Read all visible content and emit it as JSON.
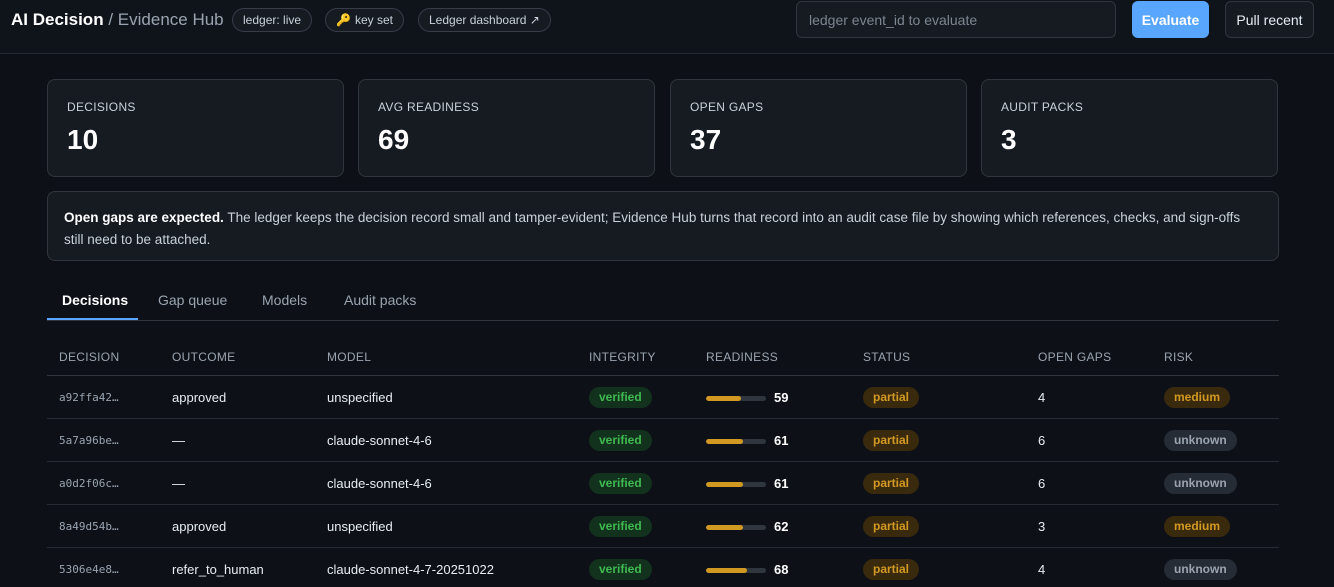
{
  "header": {
    "brand": "AI Decision",
    "separator": "/",
    "subtitle": "Evidence Hub",
    "chip_ledger": "ledger: live",
    "chip_key": "key set",
    "chip_dashboard": "Ledger dashboard ↗",
    "search_placeholder": "ledger event_id to evaluate",
    "evaluate_label": "Evaluate",
    "pull_label": "Pull recent"
  },
  "stats": [
    {
      "label": "DECISIONS",
      "value": "10"
    },
    {
      "label": "AVG READINESS",
      "value": "69"
    },
    {
      "label": "OPEN GAPS",
      "value": "37"
    },
    {
      "label": "AUDIT PACKS",
      "value": "3"
    }
  ],
  "notice": {
    "bold": "Open gaps are expected.",
    "text": " The ledger keeps the decision record small and tamper-evident; Evidence Hub turns that record into an audit case file by showing which references, checks, and sign-offs still need to be attached."
  },
  "tabs": [
    "Decisions",
    "Gap queue",
    "Models",
    "Audit packs"
  ],
  "table": {
    "columns": [
      "DECISION",
      "OUTCOME",
      "MODEL",
      "INTEGRITY",
      "READINESS",
      "STATUS",
      "OPEN GAPS",
      "RISK"
    ],
    "rows": [
      {
        "decision": "a92ffa42…",
        "outcome": "approved",
        "model": "unspecified",
        "integrity": "verified",
        "readiness": 59,
        "status": "partial",
        "gaps": "4",
        "risk": "medium"
      },
      {
        "decision": "5a7a96be…",
        "outcome": "—",
        "model": "claude-sonnet-4-6",
        "integrity": "verified",
        "readiness": 61,
        "status": "partial",
        "gaps": "6",
        "risk": "unknown"
      },
      {
        "decision": "a0d2f06c…",
        "outcome": "—",
        "model": "claude-sonnet-4-6",
        "integrity": "verified",
        "readiness": 61,
        "status": "partial",
        "gaps": "6",
        "risk": "unknown"
      },
      {
        "decision": "8a49d54b…",
        "outcome": "approved",
        "model": "unspecified",
        "integrity": "verified",
        "readiness": 62,
        "status": "partial",
        "gaps": "3",
        "risk": "medium"
      },
      {
        "decision": "5306e4e8…",
        "outcome": "refer_to_human",
        "model": "claude-sonnet-4-7-20251022",
        "integrity": "verified",
        "readiness": 68,
        "status": "partial",
        "gaps": "4",
        "risk": "unknown"
      }
    ]
  },
  "colors": {
    "accent": "#58a6ff",
    "verified": "#3fb950",
    "partial": "#d29922",
    "background": "#0d1117"
  }
}
